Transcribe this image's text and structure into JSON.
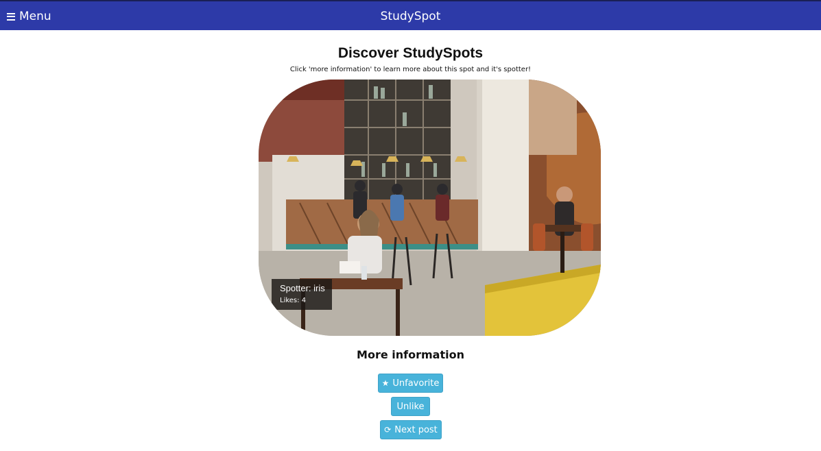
{
  "navbar": {
    "menu_label": "Menu",
    "brand": "StudySpot",
    "background": "#2d3aa8"
  },
  "header": {
    "title": "Discover StudySpots",
    "subtitle": "Click 'more information' to learn more about this spot and it's spotter!"
  },
  "post": {
    "image_alt": "Cafe interior with people studying",
    "spotter_text": "Spotter: iris",
    "likes_text": "Likes: 4"
  },
  "more_info_label": "More information",
  "buttons": {
    "favorite_label": "Unfavorite",
    "favorite_icon": "star-icon",
    "unlike_label": "Unlike",
    "next_label": "Next post",
    "next_icon": "refresh-icon",
    "color": "#48b3da"
  }
}
